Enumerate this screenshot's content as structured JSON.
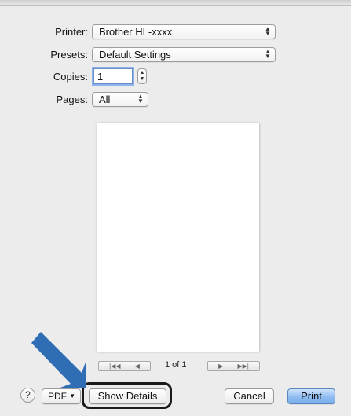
{
  "dialog": {
    "printer_label": "Printer:",
    "printer_value": "Brother HL-xxxx",
    "presets_label": "Presets:",
    "presets_value": "Default Settings",
    "copies_label": "Copies:",
    "copies_value": "1",
    "pages_label": "Pages:",
    "pages_value": "All"
  },
  "preview": {
    "page_indicator": "1 of 1",
    "first_glyph": "|◀◀",
    "prev_glyph": "◀",
    "next_glyph": "▶",
    "last_glyph": "▶▶|"
  },
  "footer": {
    "help_label": "?",
    "pdf_label": "PDF",
    "show_details_label": "Show Details",
    "cancel_label": "Cancel",
    "print_label": "Print"
  },
  "annotation": {
    "arrow_color": "#2f6db5",
    "highlight_color": "#1a1a1a"
  },
  "icons": {
    "popup_arrows": "updown-arrows-icon",
    "help": "help-icon",
    "pdf_menu": "chevron-down-icon",
    "annotation": "pointer-arrow-icon"
  }
}
